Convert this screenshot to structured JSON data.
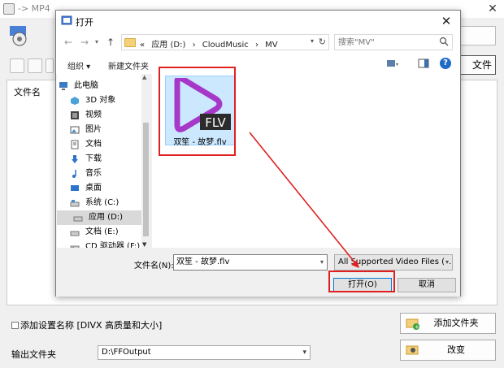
{
  "app": {
    "title": "-> MP4",
    "right_button_label": "",
    "file_button_label": "文件",
    "list_header": "文件名",
    "checkbox_label": "添加设置名称 [DIVX 高质量和大小]",
    "output_label": "输出文件夹",
    "output_path": "D:\\FFOutput",
    "add_folder_label": "添加文件夹",
    "change_label": "改变"
  },
  "dialog": {
    "title": "打开",
    "address": {
      "prefix": "«",
      "crumbs": [
        "应用 (D:)",
        "›",
        "CloudMusic",
        "›",
        "MV"
      ]
    },
    "search_placeholder": "搜索\"MV\"",
    "organize_label": "组织 ▾",
    "new_folder_label": "新建文件夹",
    "help_label": "?",
    "tree": [
      {
        "label": "此电脑",
        "icon": "computer-icon"
      },
      {
        "label": "3D 对象",
        "icon": "cube-icon"
      },
      {
        "label": "视频",
        "icon": "film-icon"
      },
      {
        "label": "图片",
        "icon": "picture-icon"
      },
      {
        "label": "文档",
        "icon": "document-icon"
      },
      {
        "label": "下载",
        "icon": "download-icon"
      },
      {
        "label": "音乐",
        "icon": "music-icon"
      },
      {
        "label": "桌面",
        "icon": "desktop-icon"
      },
      {
        "label": "系统 (C:)",
        "icon": "drive-icon"
      },
      {
        "label": "应用 (D:)",
        "icon": "drive-icon"
      },
      {
        "label": "文档 (E:)",
        "icon": "drive-icon"
      },
      {
        "label": "CD 驱动器 (F:)",
        "icon": "cd-drive-icon"
      }
    ],
    "file": {
      "name": "双笙 - 故梦.flv",
      "badge": "FLV"
    },
    "filename_label": "文件名(N):",
    "filename_value": "双笙 - 故梦.flv",
    "filetype_value": "All Supported Video Files (*.",
    "open_label": "打开(O)",
    "cancel_label": "取消"
  },
  "colors": {
    "annotation_red": "#e02020",
    "selection_blue": "#cce8ff",
    "play_purple": "#a637c9"
  }
}
